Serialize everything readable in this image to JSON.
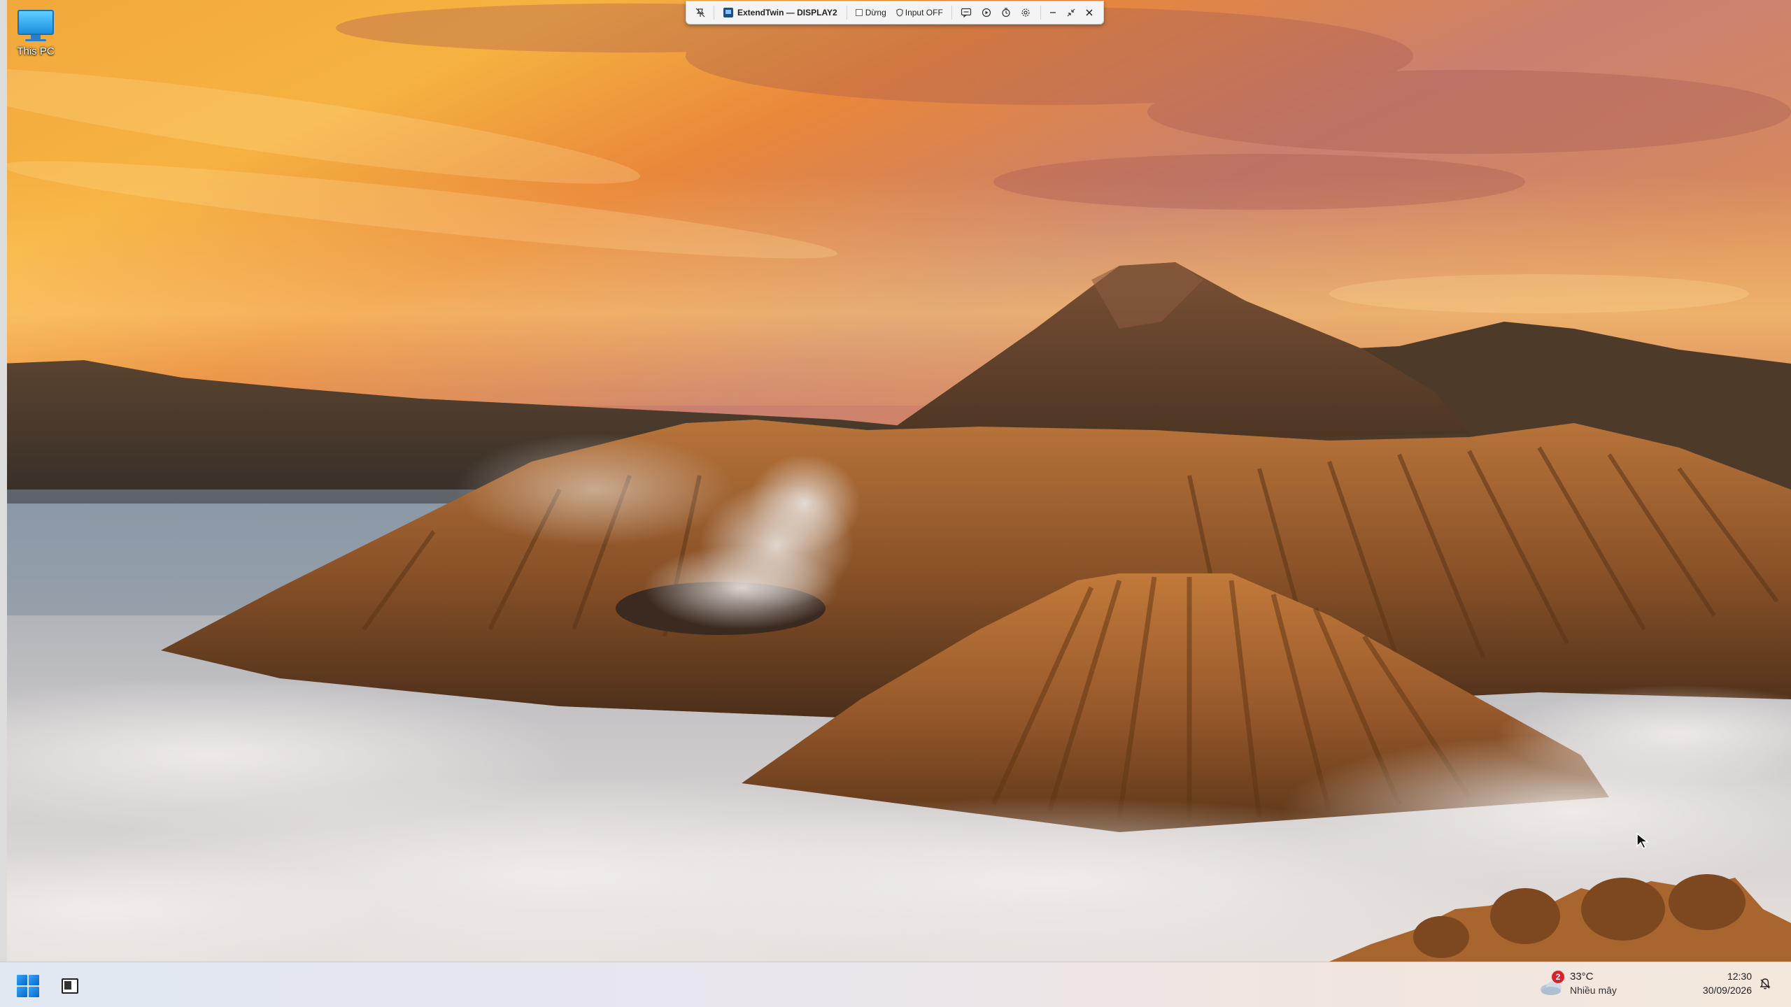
{
  "desktop": {
    "icons": [
      {
        "label": "This PC",
        "icon": "monitor-icon"
      }
    ]
  },
  "toolbar": {
    "window_title": "ExtendTwin — DISPLAY2",
    "stop_label": "Dừng",
    "input_label": "Input OFF",
    "icons": {
      "pin": "pin-off-icon",
      "chat": "chat-icon",
      "record": "record-icon",
      "timer": "timer-icon",
      "settings": "gear-icon",
      "minimize": "minimize-icon",
      "collapse": "collapse-icon",
      "close": "close-icon"
    }
  },
  "taskbar": {
    "weather": {
      "badge_count": "2",
      "temperature": "33°C",
      "condition": "Nhiều mây"
    },
    "clock": {
      "time": "12:30",
      "date": "30/09/2026"
    }
  },
  "colors": {
    "accent": "#0067c8",
    "badge": "#d8232a"
  }
}
